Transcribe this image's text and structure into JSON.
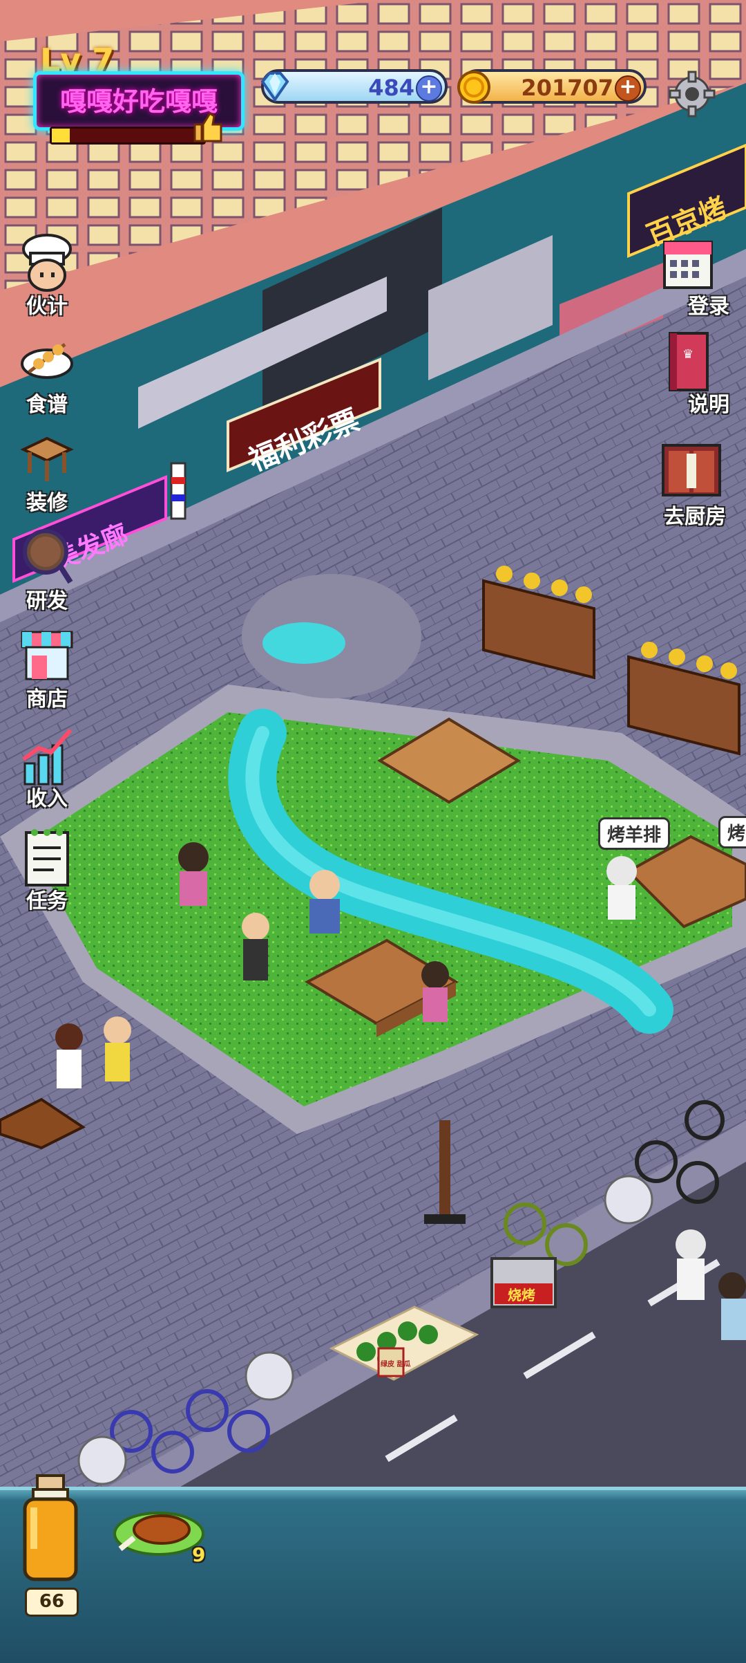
{
  "hud": {
    "level": "Lv 7",
    "shop_name": "嘎嘎好吃嘎嘎",
    "xp_progress": 0.12,
    "gems": "484",
    "coins": "201707"
  },
  "left_menu": [
    {
      "label": "伙计",
      "icon": "chef-hat-icon"
    },
    {
      "label": "食谱",
      "icon": "skewer-plate-icon"
    },
    {
      "label": "装修",
      "icon": "table-icon"
    },
    {
      "label": "研发",
      "icon": "magnifier-icon"
    },
    {
      "label": "商店",
      "icon": "shop-icon"
    },
    {
      "label": "收入",
      "icon": "bar-chart-icon"
    },
    {
      "label": "任务",
      "icon": "scroll-icon"
    }
  ],
  "right_menu": [
    {
      "label": "登录",
      "icon": "calendar-icon"
    },
    {
      "label": "说明",
      "icon": "book-icon"
    },
    {
      "label": "去厨房",
      "icon": "door-icon"
    }
  ],
  "scene": {
    "shop_signs": [
      "福利彩票",
      "美发廊",
      "百京烤"
    ],
    "order_bubbles": [
      "烤羊排",
      "烤"
    ],
    "vendor_sign": "烧烤",
    "melon_sign": "绿皮 甜瓜"
  },
  "bottom_bar": {
    "jar_count": "66",
    "food_count": "9",
    "food_icon": "lamb-chop-icon"
  },
  "colors": {
    "neon_pink": "#ff66ee",
    "neon_cyan": "#33e6ff",
    "gem_value": "#3a4ab8",
    "coin_value": "#8a3b10"
  }
}
